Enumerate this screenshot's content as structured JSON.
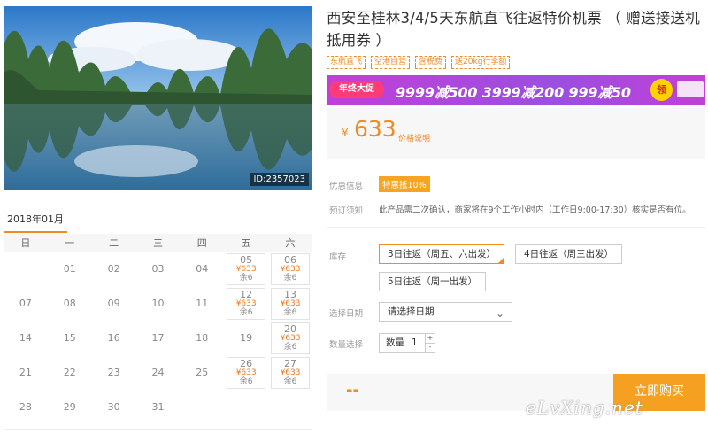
{
  "product": {
    "image_id": "ID:2357023",
    "title": "西安至桂林3/4/5天东航直飞往返特价机票 （ 赠送接送机抵用券 ）",
    "tags": [
      "东航直飞",
      "空港自营",
      "含税费",
      "送20kg行李额"
    ],
    "banner": {
      "badge": "年终大促",
      "promo": "9999减500  3999减200  999减50",
      "coupon": "领"
    },
    "price": {
      "currency": "¥",
      "amount": "633",
      "note": "价格说明"
    }
  },
  "info": {
    "discount_label": "优惠信息",
    "discount_badge": "特惠抵10%",
    "notice_label": "预订须知",
    "notice_text": "此产品需二次确认，商家将在9个工作小时内（工作日9:00-17:30）核实是否有位。"
  },
  "options": {
    "stock_label": "库存",
    "choices": [
      "3日往返（周五、六出发）",
      "4日往返（周三出发）",
      "5日往返（周一出发）"
    ],
    "selected_index": 0,
    "date_label": "选择日期",
    "date_placeholder": "请选择日期",
    "qty_label": "数量选择",
    "qty_prefix": "数量",
    "qty_value": "1",
    "qty_up": "+",
    "qty_down": "-"
  },
  "footer": {
    "total": "--",
    "buy_label": "立即购买"
  },
  "watermark": "eLvXing.net",
  "calendar": {
    "month": "2018年01月",
    "weekdays": [
      "日",
      "一",
      "二",
      "三",
      "四",
      "五",
      "六"
    ],
    "weeks": [
      [
        null,
        {
          "d": "01"
        },
        {
          "d": "02"
        },
        {
          "d": "03"
        },
        {
          "d": "04"
        },
        {
          "d": "05",
          "p": "¥633",
          "r": "余6"
        },
        {
          "d": "06",
          "p": "¥633",
          "r": "余6"
        }
      ],
      [
        {
          "d": "07"
        },
        {
          "d": "08"
        },
        {
          "d": "09"
        },
        {
          "d": "10"
        },
        {
          "d": "11"
        },
        {
          "d": "12",
          "p": "¥633",
          "r": "余6"
        },
        {
          "d": "13",
          "p": "¥633",
          "r": "余6"
        }
      ],
      [
        {
          "d": "14"
        },
        {
          "d": "15"
        },
        {
          "d": "16"
        },
        {
          "d": "17"
        },
        {
          "d": "18"
        },
        {
          "d": "19"
        },
        {
          "d": "20",
          "p": "¥633",
          "r": "余6"
        }
      ],
      [
        {
          "d": "21"
        },
        {
          "d": "22"
        },
        {
          "d": "23"
        },
        {
          "d": "24"
        },
        {
          "d": "25"
        },
        {
          "d": "26",
          "p": "¥633",
          "r": "余6"
        },
        {
          "d": "27",
          "p": "¥633",
          "r": "余6"
        }
      ],
      [
        {
          "d": "28"
        },
        {
          "d": "29"
        },
        {
          "d": "30"
        },
        {
          "d": "31"
        },
        null,
        null,
        null
      ]
    ]
  },
  "colors": {
    "accent": "#f08a24",
    "buy": "#f6a022",
    "banner": "#9b4fe0"
  }
}
